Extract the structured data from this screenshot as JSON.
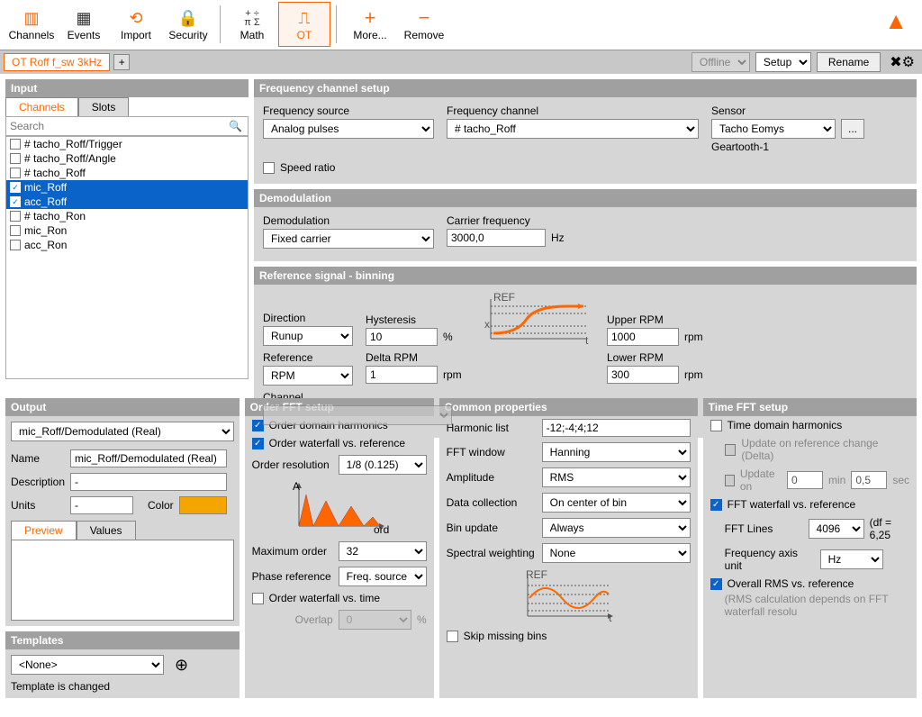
{
  "toolbar": {
    "channels": "Channels",
    "events": "Events",
    "import": "Import",
    "security": "Security",
    "math": "Math",
    "ot": "OT",
    "more": "More...",
    "remove": "Remove"
  },
  "doc_tab": "OT Roff f_sw 3kHz",
  "status_mode": "Offline",
  "view_mode": "Setup",
  "rename_btn": "Rename",
  "input": {
    "title": "Input",
    "tab_channels": "Channels",
    "tab_slots": "Slots",
    "search_placeholder": "Search",
    "items": [
      {
        "label": "# tacho_Roff/Trigger",
        "checked": false,
        "selected": false
      },
      {
        "label": "# tacho_Roff/Angle",
        "checked": false,
        "selected": false
      },
      {
        "label": "# tacho_Roff",
        "checked": false,
        "selected": false
      },
      {
        "label": "mic_Roff",
        "checked": true,
        "selected": true
      },
      {
        "label": "acc_Roff",
        "checked": true,
        "selected": false
      },
      {
        "label": "# tacho_Ron",
        "checked": false,
        "selected": false
      },
      {
        "label": "mic_Ron",
        "checked": false,
        "selected": false
      },
      {
        "label": "acc_Ron",
        "checked": false,
        "selected": false
      }
    ]
  },
  "freq_setup": {
    "title": "Frequency channel setup",
    "source_label": "Frequency source",
    "source_value": "Analog pulses",
    "channel_label": "Frequency channel",
    "channel_value": "# tacho_Roff",
    "sensor_label": "Sensor",
    "sensor_value": "Tacho Eomys",
    "sensor_sub": "Geartooth-1",
    "ellipsis": "...",
    "speed_ratio": "Speed ratio"
  },
  "demod": {
    "title": "Demodulation",
    "label": "Demodulation",
    "value": "Fixed carrier",
    "carrier_label": "Carrier frequency",
    "carrier_value": "3000,0",
    "carrier_unit": "Hz"
  },
  "refsig": {
    "title": "Reference signal - binning",
    "direction_label": "Direction",
    "direction_value": "Runup",
    "hysteresis_label": "Hysteresis",
    "hysteresis_value": "10",
    "hysteresis_unit": "%",
    "upper_label": "Upper RPM",
    "upper_value": "1000",
    "rpm_unit": "rpm",
    "reference_label": "Reference",
    "reference_value": "RPM",
    "delta_label": "Delta RPM",
    "delta_value": "1",
    "lower_label": "Lower RPM",
    "lower_value": "300",
    "channel_label": "Channel"
  },
  "output": {
    "title": "Output",
    "select_value": "mic_Roff/Demodulated (Real)",
    "name_label": "Name",
    "name_value": "mic_Roff/Demodulated (Real)",
    "desc_label": "Description",
    "desc_value": "-",
    "units_label": "Units",
    "units_value": "-",
    "color_label": "Color",
    "color_value": "#f5a500",
    "preview_tab": "Preview",
    "values_tab": "Values"
  },
  "orderfft": {
    "title": "Order FFT setup",
    "order_harm": "Order domain harmonics",
    "order_wf_ref": "Order waterfall vs. reference",
    "order_res_label": "Order resolution",
    "order_res_value": "1/8 (0.125)",
    "max_order_label": "Maximum order",
    "max_order_value": "32",
    "phase_ref_label": "Phase reference",
    "phase_ref_value": "Freq. source",
    "order_wf_time": "Order waterfall vs. time",
    "overlap_label": "Overlap",
    "overlap_value": "0",
    "overlap_unit": "%",
    "diag_y": "A",
    "diag_x": "ord"
  },
  "common": {
    "title": "Common properties",
    "harm_label": "Harmonic list",
    "harm_value": "-12;-4;4;12",
    "fftwin_label": "FFT window",
    "fftwin_value": "Hanning",
    "amp_label": "Amplitude",
    "amp_value": "RMS",
    "datacol_label": "Data collection",
    "datacol_value": "On center of bin",
    "binupd_label": "Bin update",
    "binupd_value": "Always",
    "specw_label": "Spectral weighting",
    "specw_value": "None",
    "skip_bins": "Skip missing bins",
    "diag_ref": "REF",
    "diag_t": "t"
  },
  "timefft": {
    "title": "Time FFT setup",
    "time_harm": "Time domain harmonics",
    "upd_ref": "Update on reference change (Delta)",
    "upd_on": "Update on",
    "upd_on_val": "0",
    "upd_min": "min",
    "upd_sec_val": "0,5",
    "upd_sec": "sec",
    "fft_wf_ref": "FFT waterfall vs. reference",
    "fft_lines_label": "FFT Lines",
    "fft_lines_value": "4096",
    "df": "(df = 6,25",
    "freq_axis_label": "Frequency axis unit",
    "freq_axis_value": "Hz",
    "overall_rms": "Overall RMS vs. reference",
    "rms_note": "(RMS calculation depends on FFT waterfall resolu"
  },
  "templates": {
    "title": "Templates",
    "value": "<None>",
    "note": "Template is changed"
  }
}
